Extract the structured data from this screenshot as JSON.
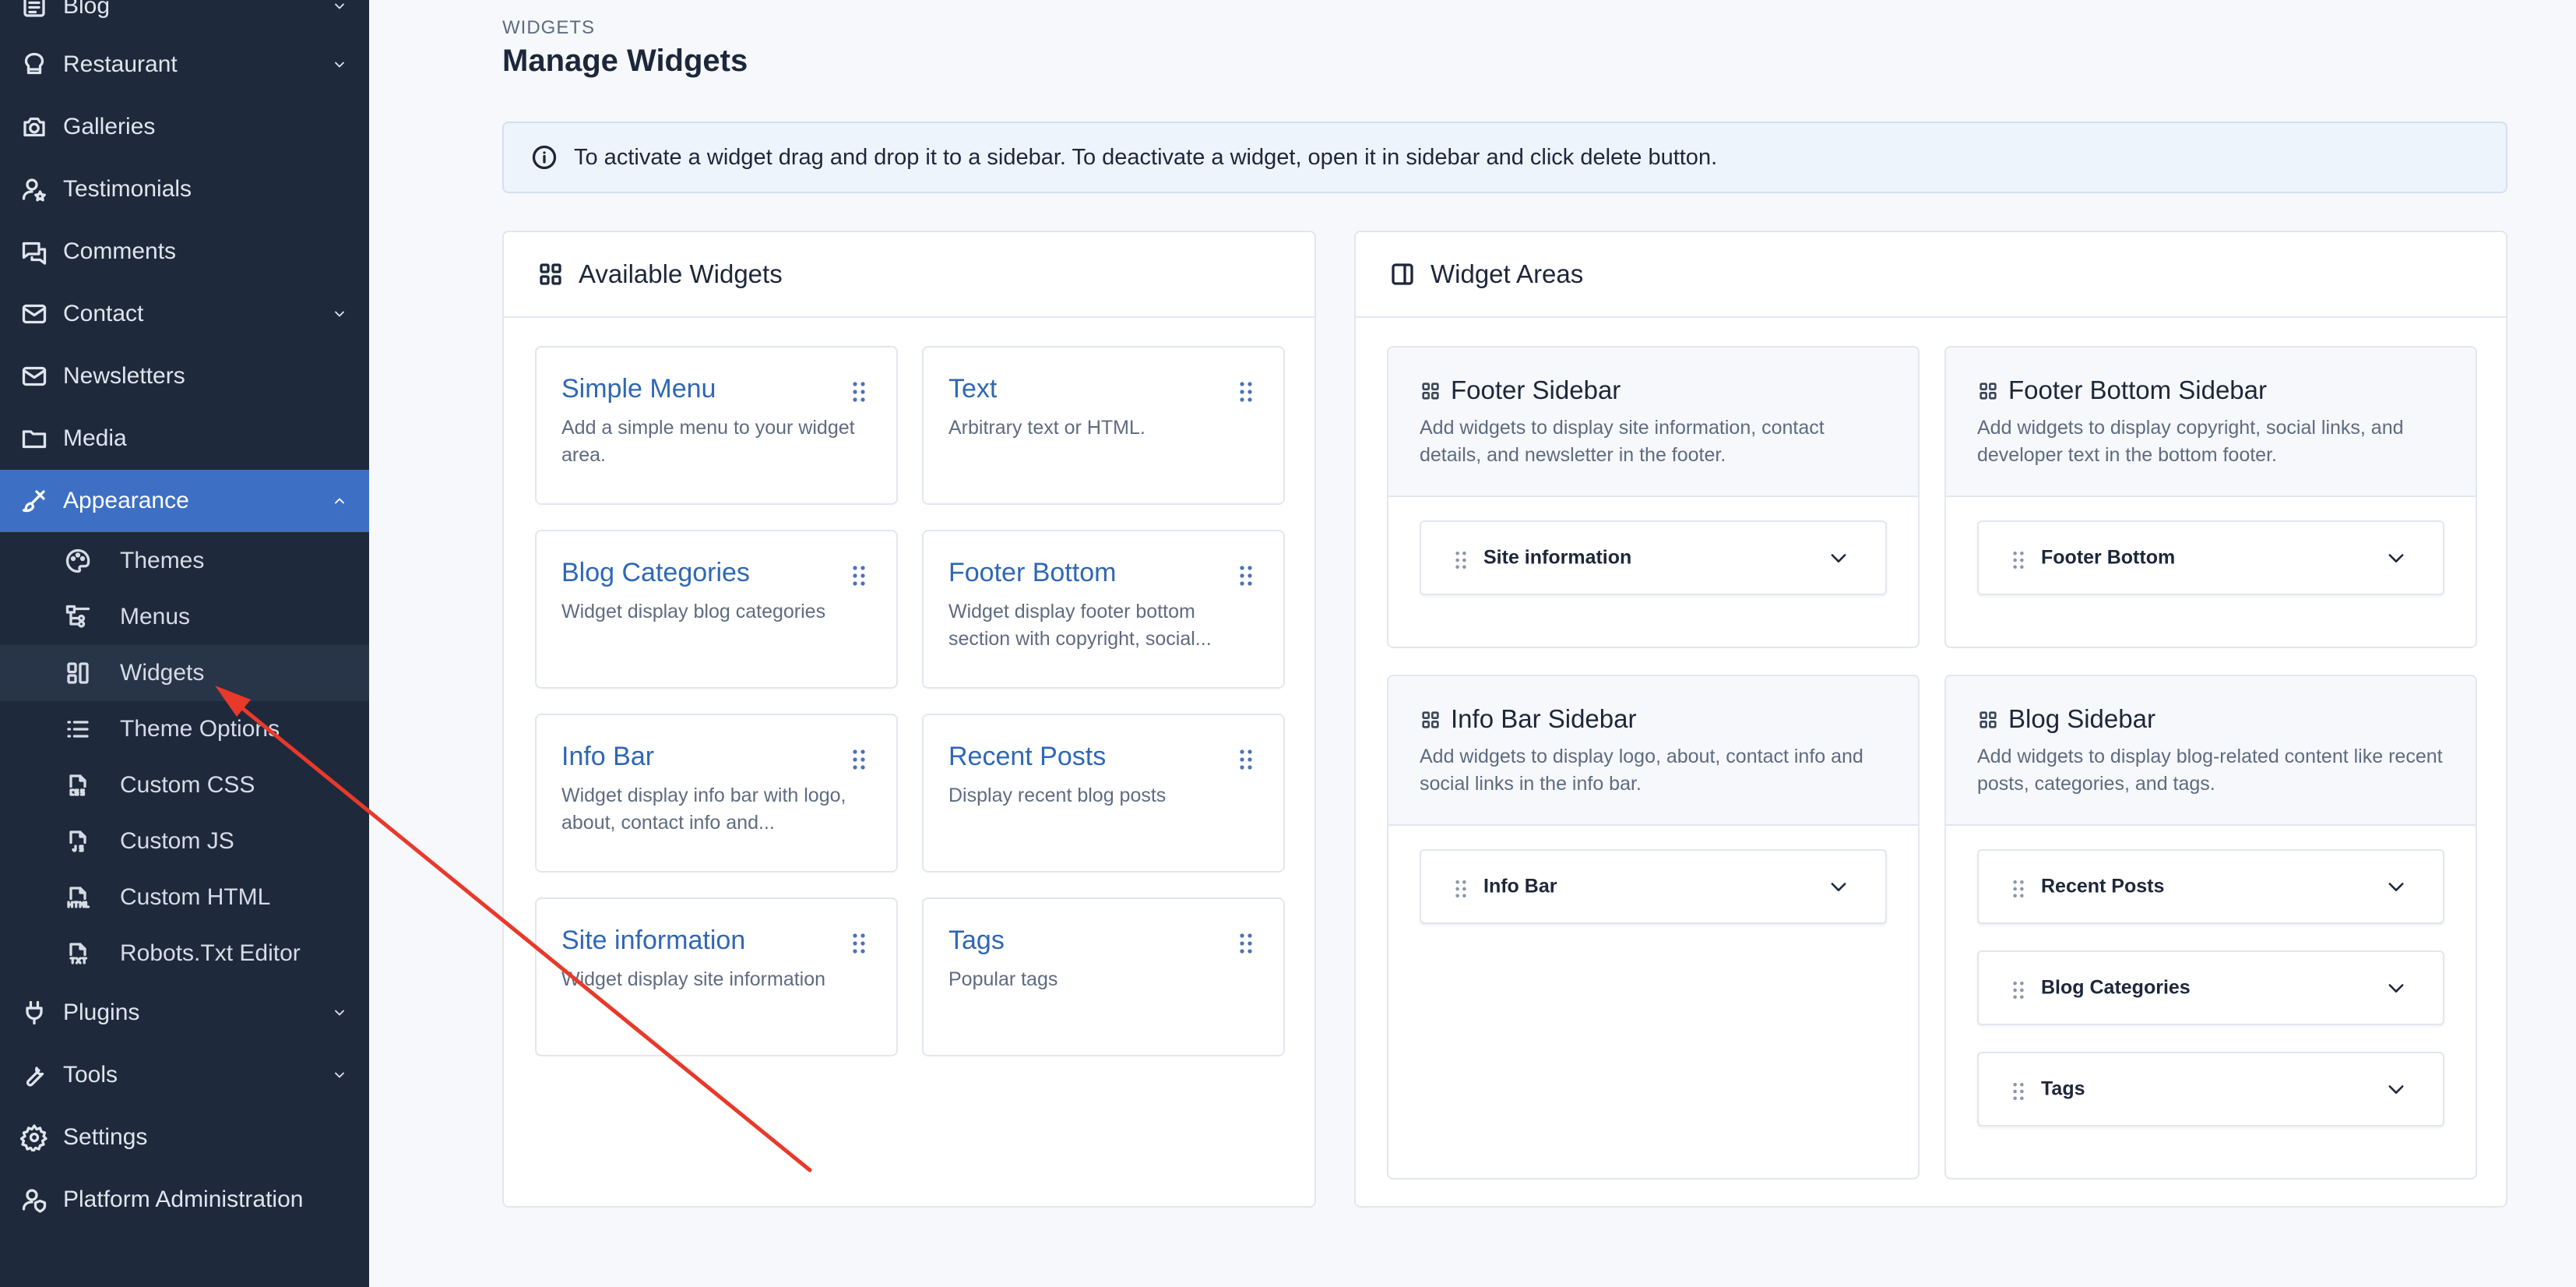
{
  "sidebar": {
    "items": [
      {
        "label": "Blog",
        "icon": "blog-icon"
      },
      {
        "label": "Restaurant",
        "icon": "restaurant-icon"
      },
      {
        "label": "Galleries",
        "icon": "camera-icon"
      },
      {
        "label": "Testimonials",
        "icon": "user-star-icon"
      },
      {
        "label": "Comments",
        "icon": "comments-icon"
      },
      {
        "label": "Contact",
        "icon": "mail-icon"
      },
      {
        "label": "Newsletters",
        "icon": "mail-icon"
      },
      {
        "label": "Media",
        "icon": "folder-icon"
      },
      {
        "label": "Appearance",
        "icon": "brush-icon"
      }
    ],
    "sub_items": [
      {
        "label": "Themes",
        "icon": "palette-icon"
      },
      {
        "label": "Menus",
        "icon": "menu-tree-icon"
      },
      {
        "label": "Widgets",
        "icon": "widgets-icon"
      },
      {
        "label": "Theme Options",
        "icon": "list-icon"
      },
      {
        "label": "Custom CSS",
        "icon": "css-file-icon"
      },
      {
        "label": "Custom JS",
        "icon": "js-file-icon"
      },
      {
        "label": "Custom HTML",
        "icon": "html-file-icon"
      },
      {
        "label": "Robots.Txt Editor",
        "icon": "txt-file-icon"
      }
    ],
    "bottom_items": [
      {
        "label": "Plugins",
        "icon": "plug-icon"
      },
      {
        "label": "Tools",
        "icon": "wrench-icon"
      },
      {
        "label": "Settings",
        "icon": "gear-icon"
      },
      {
        "label": "Platform Administration",
        "icon": "user-shield-icon"
      }
    ],
    "active_color": "#3d6fc4",
    "background": "#1e293b"
  },
  "header": {
    "eyebrow": "WIDGETS",
    "title": "Manage Widgets"
  },
  "alert": {
    "text": "To activate a widget drag and drop it to a sidebar. To deactivate a widget, open it in sidebar and click delete button."
  },
  "available": {
    "title": "Available Widgets",
    "widgets": [
      {
        "title": "Simple Menu",
        "desc": "Add a simple menu to your widget area."
      },
      {
        "title": "Text",
        "desc": "Arbitrary text or HTML."
      },
      {
        "title": "Blog Categories",
        "desc": "Widget display blog categories"
      },
      {
        "title": "Footer Bottom",
        "desc": "Widget display footer bottom section with copyright, social..."
      },
      {
        "title": "Info Bar",
        "desc": "Widget display info bar with logo, about, contact info and..."
      },
      {
        "title": "Recent Posts",
        "desc": "Display recent blog posts"
      },
      {
        "title": "Site information",
        "desc": "Widget display site information"
      },
      {
        "title": "Tags",
        "desc": "Popular tags"
      }
    ]
  },
  "areas": {
    "title": "Widget Areas",
    "list": [
      {
        "title": "Footer Sidebar",
        "desc": "Add widgets to display site information, contact details, and newsletter in the footer.",
        "slots": [
          "Site information"
        ]
      },
      {
        "title": "Footer Bottom Sidebar",
        "desc": "Add widgets to display copyright, social links, and developer text in the bottom footer.",
        "slots": [
          "Footer Bottom"
        ]
      },
      {
        "title": "Info Bar Sidebar",
        "desc": "Add widgets to display logo, about, contact info and social links in the info bar.",
        "slots": [
          "Info Bar"
        ]
      },
      {
        "title": "Blog Sidebar",
        "desc": "Add widgets to display blog-related content like recent posts, categories, and tags.",
        "slots": [
          "Recent Posts",
          "Blog Categories",
          "Tags"
        ]
      }
    ]
  },
  "annotation": {
    "arrow_color": "#e8392b"
  }
}
